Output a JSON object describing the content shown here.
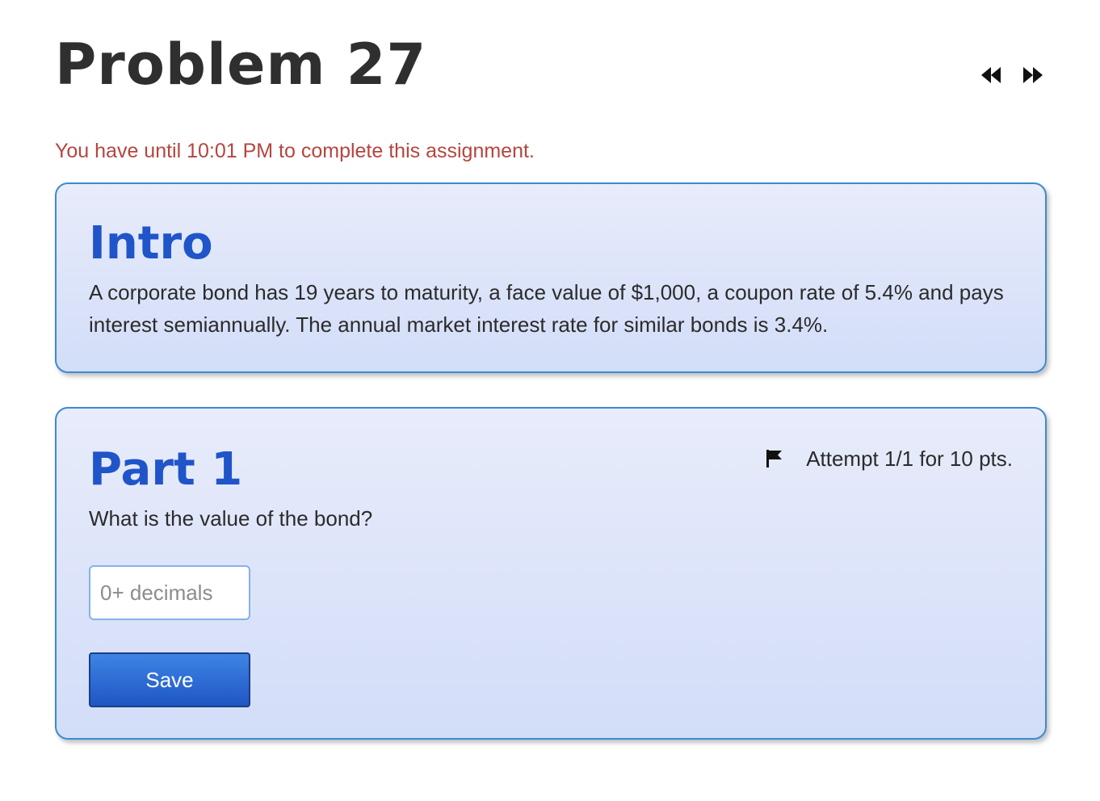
{
  "header": {
    "title": "Problem 27",
    "prev_icon": "rewind-icon",
    "next_icon": "fast-forward-icon"
  },
  "deadline": "You have until 10:01 PM to complete this assignment.",
  "intro": {
    "title": "Intro",
    "text": "A corporate bond has 19 years to maturity, a face value of $1,000, a coupon rate of 5.4% and pays interest semiannually. The annual market interest rate for similar bonds is 3.4%."
  },
  "part": {
    "title": "Part 1",
    "attempt": "Attempt 1/1 for 10 pts.",
    "flag_icon": "flag-icon",
    "question": "What is the value of the bond?",
    "input_value": "",
    "input_placeholder": "0+ decimals",
    "save_label": "Save"
  },
  "colors": {
    "title_blue": "#1f55c9",
    "deadline_red": "#b5453f",
    "card_border": "#3b8bd0",
    "button_blue": "#2f6fd6"
  }
}
